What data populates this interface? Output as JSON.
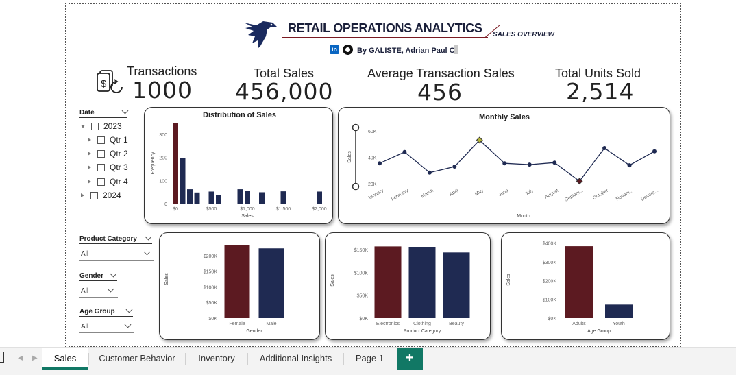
{
  "header": {
    "title": "RETAIL OPERATIONS ANALYTICS",
    "subtitle": "SALES OVERVIEW",
    "byline": "By GALISTE, Adrian Paul C.",
    "linkedin_glyph": "in",
    "brand_color": "#1a2a5e",
    "accent_color": "#7a1a22"
  },
  "kpis": [
    {
      "label": "Transactions",
      "value": "1000",
      "icon": "receipt-refresh-icon"
    },
    {
      "label": "Total Sales",
      "value": "456,000"
    },
    {
      "label": "Average Transaction Sales",
      "value": "456"
    },
    {
      "label": "Total Units Sold",
      "value": "2,514"
    }
  ],
  "filters": {
    "date": {
      "title": "Date",
      "tree": [
        {
          "label": "2023",
          "expanded": true
        },
        {
          "label": "Qtr 1"
        },
        {
          "label": "Qtr 2"
        },
        {
          "label": "Qtr 3"
        },
        {
          "label": "Qtr 4"
        },
        {
          "label": "2024",
          "expanded": false
        }
      ]
    },
    "product_category": {
      "title": "Product Category",
      "value": "All"
    },
    "gender": {
      "title": "Gender",
      "value": "All"
    },
    "age_group": {
      "title": "Age Group",
      "value": "All"
    }
  },
  "colors": {
    "dark_red": "#5c1a21",
    "navy": "#1f2a52",
    "kpi_text": "#222222",
    "tab_accent": "#117865"
  },
  "chart_data": [
    {
      "type": "bar",
      "title": "Distribution of Sales",
      "xlabel": "Sales",
      "ylabel": "Frequency",
      "x_ticks": [
        "$0",
        "$500",
        "$1,000",
        "$1,500",
        "$2,000"
      ],
      "y_ticks": [
        "0",
        "100",
        "200",
        "300"
      ],
      "ylim": [
        0,
        350
      ],
      "x_range": [
        0,
        2000
      ],
      "bins": [
        {
          "x": 0,
          "value": 350,
          "highlight": true
        },
        {
          "x": 100,
          "value": 196
        },
        {
          "x": 200,
          "value": 62
        },
        {
          "x": 300,
          "value": 48
        },
        {
          "x": 500,
          "value": 52
        },
        {
          "x": 600,
          "value": 38
        },
        {
          "x": 900,
          "value": 62
        },
        {
          "x": 1000,
          "value": 55
        },
        {
          "x": 1200,
          "value": 49
        },
        {
          "x": 1500,
          "value": 53
        },
        {
          "x": 2000,
          "value": 52
        }
      ]
    },
    {
      "type": "line",
      "title": "Monthly Sales",
      "xlabel": "Month",
      "ylabel": "Sales",
      "y_ticks": [
        "20K",
        "40K",
        "60K"
      ],
      "ylim": [
        18000,
        62000
      ],
      "categories": [
        "January",
        "February",
        "March",
        "April",
        "May",
        "June",
        "July",
        "August",
        "Septem...",
        "October",
        "Novem...",
        "Decem..."
      ],
      "values": [
        35500,
        44000,
        28500,
        33000,
        53000,
        35500,
        34500,
        36000,
        22000,
        47000,
        34000,
        44500
      ],
      "max_index": 4,
      "min_index": 8
    },
    {
      "type": "bar",
      "xlabel": "Gender",
      "ylabel": "Sales",
      "y_ticks": [
        "$0K",
        "$50K",
        "$100K",
        "$150K",
        "$200K"
      ],
      "ylim": [
        0,
        250000
      ],
      "categories": [
        "Female",
        "Male"
      ],
      "values": [
        232840,
        223160
      ],
      "highlight_index": 0
    },
    {
      "type": "bar",
      "xlabel": "Product Category",
      "ylabel": "Sales",
      "y_ticks": [
        "$0K",
        "$50K",
        "$100K",
        "$150K"
      ],
      "ylim": [
        0,
        165000
      ],
      "categories": [
        "Electronics",
        "Clothing",
        "Beauty"
      ],
      "values": [
        156905,
        155580,
        143515
      ],
      "highlight_index": 0
    },
    {
      "type": "bar",
      "xlabel": "Age Group",
      "ylabel": "Sales",
      "y_ticks": [
        "$0K",
        "$100K",
        "$200K",
        "$300K",
        "$400K"
      ],
      "ylim": [
        0,
        410000
      ],
      "categories": [
        "Adults",
        "Youth"
      ],
      "values": [
        384000,
        72000
      ],
      "highlight_index": 0
    }
  ],
  "tabs": [
    {
      "label": "Sales",
      "active": true
    },
    {
      "label": "Customer Behavior"
    },
    {
      "label": "Inventory"
    },
    {
      "label": "Additional Insights"
    },
    {
      "label": "Page 1"
    }
  ],
  "add_tab_label": "+"
}
